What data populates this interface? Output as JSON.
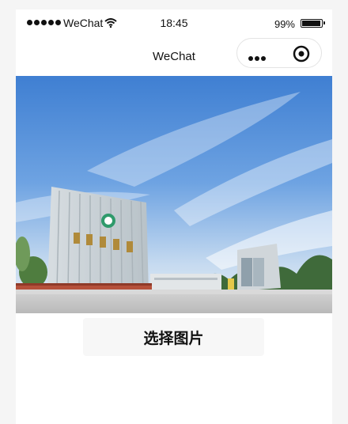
{
  "status_bar": {
    "carrier": "WeChat",
    "time": "18:45",
    "battery_percent": "99%",
    "battery_level": 0.99,
    "signal_icon": "signal-dots-icon",
    "wifi_icon": "wifi-icon"
  },
  "nav_bar": {
    "title": "WeChat",
    "more_icon": "more-dots-icon",
    "close_icon": "close-circle-icon"
  },
  "main": {
    "banner_image": "campus-gate-photo",
    "choose_button_label": "选择图片"
  }
}
